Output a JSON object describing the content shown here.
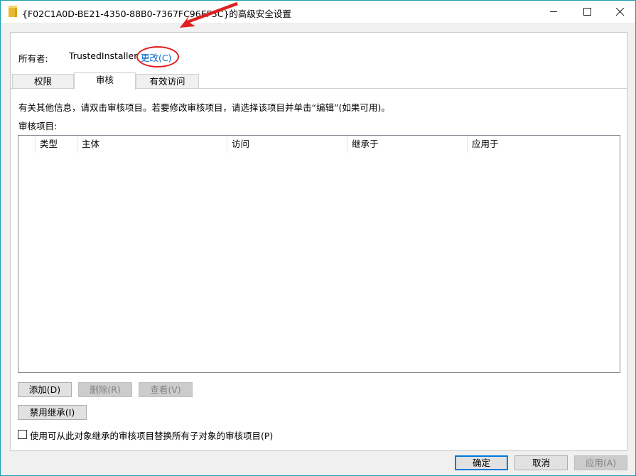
{
  "window": {
    "title": "{F02C1A0D-BE21-4350-88B0-7367FC96EF3C}的高级安全设置",
    "controls": {
      "minimize": "─",
      "maximize": "☐",
      "close": "✕"
    }
  },
  "owner": {
    "label": "所有者:",
    "value": "TrustedInstaller",
    "change_link": "更改(C)"
  },
  "tabs": [
    {
      "label": "权限",
      "active": false
    },
    {
      "label": "审核",
      "active": true
    },
    {
      "label": "有效访问",
      "active": false
    }
  ],
  "audit": {
    "info_text": "有关其他信息，请双击审核项目。若要修改审核项目，请选择该项目并单击“编辑”(如果可用)。",
    "list_label": "审核项目:",
    "columns": [
      "类型",
      "主体",
      "访问",
      "继承于",
      "应用于"
    ],
    "rows": []
  },
  "buttons": {
    "add": "添加(D)",
    "remove": "删除(R)",
    "view": "查看(V)",
    "disable_inheritance": "禁用继承(I)"
  },
  "checkbox": {
    "label": "使用可从此对象继承的审核项目替换所有子对象的审核项目(P)",
    "checked": false
  },
  "footer": {
    "ok": "确定",
    "cancel": "取消",
    "apply": "应用(A)"
  },
  "colors": {
    "link": "#0066cc",
    "annotation": "#e02020",
    "border_accent": "#1aa0b0"
  }
}
